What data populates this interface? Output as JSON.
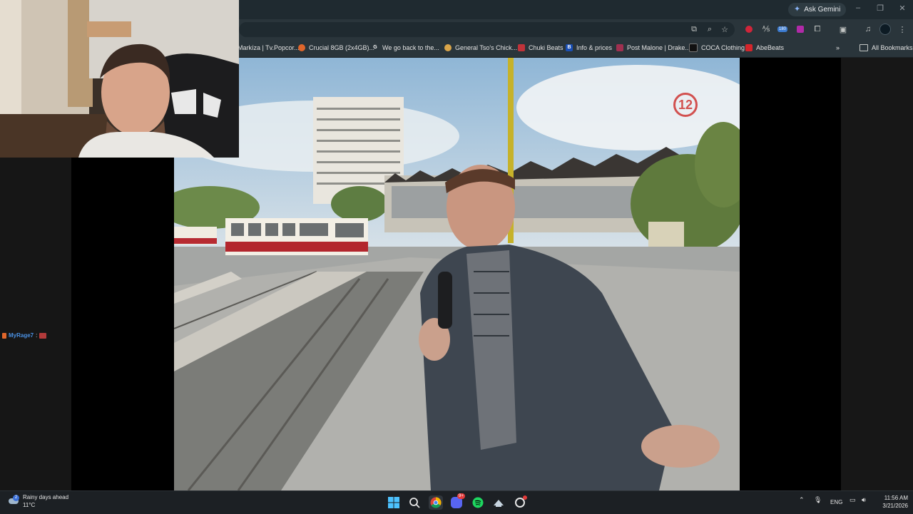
{
  "browser": {
    "ask_gemini": "Ask Gemini",
    "bookmarks": [
      {
        "label": "Markíza | Tv.Popcor...",
        "color": "#2b2b2b"
      },
      {
        "label": "Crucial 8GB (2x4GB)...",
        "color": "#e0662b"
      },
      {
        "label": "We go back to the...",
        "color": "#ffffff"
      },
      {
        "label": "General Tso's Chick...",
        "color": "#d9a54a"
      },
      {
        "label": "Chuki Beats",
        "color": "#c0333a"
      },
      {
        "label": "Info & prices",
        "color": "#1a4fb5"
      },
      {
        "label": "Post Malone | Drake...",
        "color": "#a03050"
      },
      {
        "label": "COCA Clothing",
        "color": "#111111"
      },
      {
        "label": "AbeBeats",
        "color": "#d4252b"
      }
    ],
    "all_bookmarks": "All Bookmarks",
    "extension_badge": "180"
  },
  "chat": {
    "username": "MyRage7",
    "separator": ":"
  },
  "video": {
    "channel_logo_text": "12"
  },
  "taskbar": {
    "weather_title": "Rainy days ahead",
    "weather_temp": "11°C",
    "notification_badge": "2",
    "discord_badge": "9+",
    "language": "ENG",
    "time": "11:56 AM",
    "date": "3/21/2026"
  }
}
